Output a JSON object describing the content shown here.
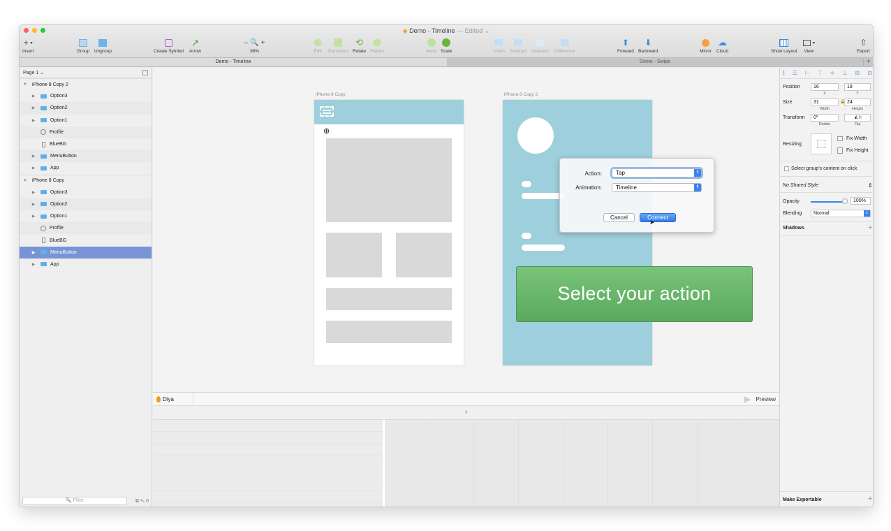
{
  "window": {
    "title": "Demo - Timeline",
    "edited_label": "— Edited ⌄",
    "traffic_colors": [
      "#fd5f57",
      "#fdbc2e",
      "#28c840"
    ]
  },
  "toolbar": {
    "insert": "Insert",
    "group": "Group",
    "ungroup": "Ungroup",
    "create_symbol": "Create Symbol",
    "arrow": "Arrow",
    "zoom_controls": "– 🔍 +",
    "zoom_value": "89%",
    "edit": "Edit",
    "transform": "Transform",
    "rotate": "Rotate",
    "flatten": "Flatten",
    "mask": "Mask",
    "scale": "Scale",
    "union": "Union",
    "subtract": "Subtract",
    "intersect": "Intersect",
    "difference": "Difference",
    "forward": "Forward",
    "backward": "Backward",
    "mirror": "Mirror",
    "cloud": "Cloud",
    "show_layout": "Show Layout",
    "view": "View",
    "export": "Export"
  },
  "tabs": [
    "Demo - Timeline",
    "Demo - Swipe"
  ],
  "tab_plus": "+",
  "layers": {
    "page": "Page 1 ⌄",
    "items": [
      {
        "label": "iPhone 8 Copy 2",
        "type": "artboard"
      },
      {
        "label": "Option3",
        "type": "folder"
      },
      {
        "label": "Option2",
        "type": "folder"
      },
      {
        "label": "Option1",
        "type": "folder"
      },
      {
        "label": "Profile",
        "type": "oval"
      },
      {
        "label": "BlueBG",
        "type": "rect"
      },
      {
        "label": "MenuButton",
        "type": "folder"
      },
      {
        "label": "App",
        "type": "folder"
      },
      {
        "label": "iPhone 8 Copy",
        "type": "artboard"
      },
      {
        "label": "Option3",
        "type": "folder"
      },
      {
        "label": "Option2",
        "type": "folder"
      },
      {
        "label": "Option1",
        "type": "folder"
      },
      {
        "label": "Profile",
        "type": "oval"
      },
      {
        "label": "BlueBG",
        "type": "rect"
      },
      {
        "label": "MenuButton",
        "type": "folder",
        "selected": true
      },
      {
        "label": "App",
        "type": "folder"
      }
    ],
    "filter_placeholder": "🔍 Filter",
    "filter_icons": "⧉ ✎ 0"
  },
  "canvas": {
    "artboard1_label": "iPhone 8 Copy",
    "artboard2_label": "iPhone 8 Copy 2",
    "header_color": "#9dcfdc",
    "menu_glyph": "⊕"
  },
  "popover": {
    "action_label": "Action:",
    "action_value": "Tap",
    "animation_label": "Animation:",
    "animation_value": "Timeline",
    "cancel": "Cancel",
    "connect": "Connect"
  },
  "callout": "Select your action",
  "prototype": {
    "name": "Diya",
    "preview": "Preview",
    "nav": "›"
  },
  "inspector": {
    "position_label": "Position",
    "x_value": "16",
    "y_value": "18",
    "x_label": "X",
    "y_label": "Y",
    "size_label": "Size",
    "width_value": "31",
    "height_value": "24",
    "width_label": "Width",
    "height_label": "Height",
    "transform_label": "Transform",
    "rotate_value": "0º",
    "rotate_label": "Rotate",
    "flip_label": "Flip",
    "resizing_label": "Resizing",
    "fix_width": "Fix Width",
    "fix_height": "Fix Height",
    "select_group": "Select group's content on click",
    "shared_style": "No Shared Style",
    "opacity_label": "Opacity",
    "opacity_value": "100%",
    "blending_label": "Blending",
    "blending_value": "Normal",
    "shadows_label": "Shadows",
    "make_exportable": "Make Exportable"
  }
}
